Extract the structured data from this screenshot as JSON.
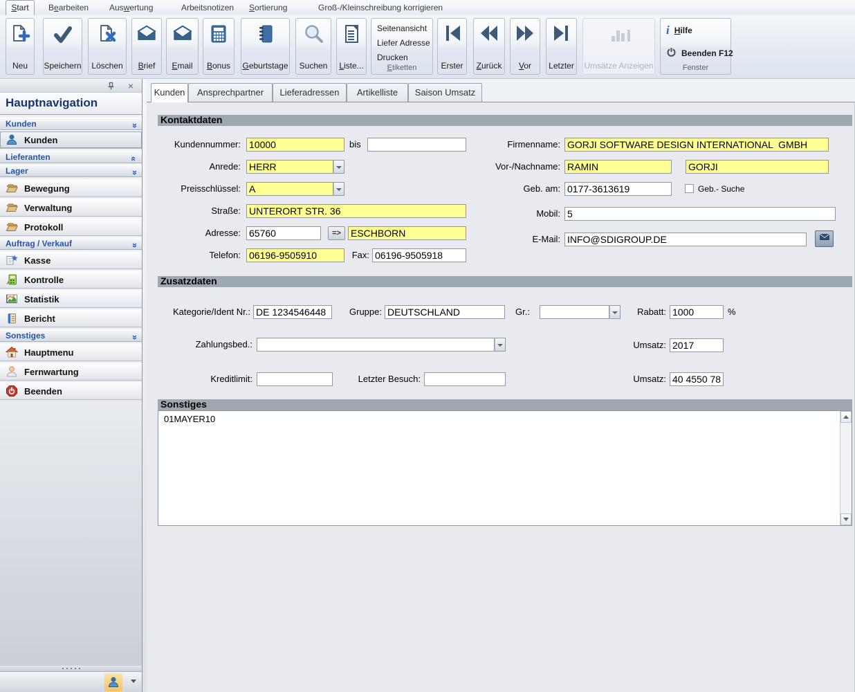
{
  "colors": {
    "field_yellow": "#FFFF94",
    "section_bar_gray": "#9EA8B1",
    "sidebar_header_text": "#2456AE",
    "nav_title_text": "#17356E",
    "ribbon_icon_blue": "#2F6BBF",
    "ribbon_icon_slate": "#3D5A78"
  },
  "icons": {
    "neu": "document-plus-icon",
    "speichern": "checkmark-icon",
    "loeschen": "document-x-icon",
    "brief": "envelope-icon",
    "email": "envelope-icon",
    "bonus": "calculator-icon",
    "geburtstage": "notebook-icon",
    "suchen": "magnifier-icon",
    "liste": "list-document-icon",
    "erster": "first-record-icon",
    "zurueck": "previous-record-icon",
    "vor": "next-record-icon",
    "letzter": "last-record-icon",
    "umsaetze": "bar-chart-icon",
    "hilfe": "info-icon",
    "beenden": "power-icon",
    "kunden": "person-blue-icon",
    "lager": "folder-icon",
    "kasse": "sheet-star-icon",
    "kontrolle": "calculator-green-icon",
    "statistik": "chart-icon",
    "bericht": "book-icon",
    "hauptmenu": "house-icon",
    "fernwartung": "person-icon",
    "beenden_rot": "power-red-icon"
  },
  "menu": {
    "items": [
      {
        "label": "_S_tart",
        "active": true
      },
      {
        "label": "B_e_arbeiten"
      },
      {
        "label": "Aus_w_ertung"
      },
      {
        "label": "Arbeitsnotizen"
      },
      {
        "label": "_S_ortierung"
      },
      {
        "label": "Groß-/Kleinschreibung korrigieren"
      }
    ]
  },
  "ribbon": {
    "neu": "Neu",
    "speichern": "Speichern",
    "loeschen": "Löschen",
    "brief": "_B_rief",
    "email": "_E_mail",
    "bonus": "_B_onus",
    "geburtstage": "_G_eburtstage",
    "suchen": "Suchen",
    "liste": "_L_iste...",
    "etiketten": {
      "items": [
        "Seitenansicht",
        "Liefer Adresse",
        "Drucken"
      ],
      "label": "_E_tiketten"
    },
    "erster": "Erster",
    "zurueck": "_Z_urück",
    "vor": "_V_or",
    "letzter": "Letzter",
    "umsaetze": "Umsätze Anzeigen",
    "fenster": {
      "hilfe": "_H_ilfe",
      "beenden": "Beenden F12",
      "label": "Fenster"
    }
  },
  "sidebar": {
    "title": "Hauptnavigation",
    "rows": [
      {
        "type": "header",
        "label": "Kunden",
        "chevron": "up"
      },
      {
        "type": "item",
        "label": "Kunden",
        "icon": "person-blue-icon",
        "selected": true
      },
      {
        "type": "header",
        "label": "Lieferanten",
        "chevron": "down"
      },
      {
        "type": "header",
        "label": "Lager",
        "chevron": "up"
      },
      {
        "type": "item",
        "label": "Bewegung",
        "icon": "folder-icon"
      },
      {
        "type": "item",
        "label": "Verwaltung",
        "icon": "folder-icon"
      },
      {
        "type": "item",
        "label": "Protokoll",
        "icon": "folder-icon"
      },
      {
        "type": "header",
        "label": "Auftrag / Verkauf",
        "chevron": "up"
      },
      {
        "type": "item",
        "label": "Kasse",
        "icon": "sheet-star-icon"
      },
      {
        "type": "item",
        "label": "Kontrolle",
        "icon": "calculator-green-icon"
      },
      {
        "type": "item",
        "label": "Statistik",
        "icon": "chart-icon"
      },
      {
        "type": "item",
        "label": "Bericht",
        "icon": "book-icon"
      },
      {
        "type": "header",
        "label": "Sonstiges",
        "chevron": "up"
      },
      {
        "type": "item",
        "label": "Hauptmenu",
        "icon": "house-icon"
      },
      {
        "type": "item",
        "label": "Fernwartung",
        "icon": "person-icon"
      },
      {
        "type": "item",
        "label": "Beenden",
        "icon": "power-red-icon"
      }
    ]
  },
  "tabs": {
    "items": [
      "Kunden",
      "Ansprechpartner",
      "Lieferadressen",
      "Artikelliste",
      "Saison Umsatz"
    ],
    "active": "Kunden"
  },
  "form": {
    "kontakt": {
      "title": "Kontaktdaten",
      "kundennummer_label": "Kundennummer:",
      "kundennummer_value": "10000",
      "bis_label": "bis",
      "bis_value": "",
      "anrede_label": "Anrede:",
      "anrede_value": "HERR",
      "preisschluessel_label": "Preisschlüssel:",
      "preisschluessel_value": "A",
      "strasse_label": "Straße:",
      "strasse_value": "UNTERORT STR. 36",
      "adresse_label": "Adresse:",
      "plz_value": "65760",
      "plz_zu_ort_button": "=>",
      "ort_value": "ESCHBORN",
      "telefon_label": "Telefon:",
      "telefon_value": "06196-9505910",
      "fax_label": "Fax:",
      "fax_value": "06196-9505918",
      "firmenname_label": "Firmenname:",
      "firmenname_value": "GORJI SOFTWARE DESIGN INTERNATIONAL  GMBH",
      "vor_nachname_label": "Vor-/Nachname:",
      "vorname_value": "RAMIN",
      "nachname_value": "GORJI",
      "geb_am_label": "Geb. am:",
      "geb_am_value": "0177-3613619",
      "geb_suche_label": "Geb.- Suche",
      "geb_suche_checked": false,
      "mobil_label": "Mobil:",
      "mobil_value": "5",
      "email_label": "E-Mail:",
      "email_value": "INFO@SDIGROUP.DE"
    },
    "zusatz": {
      "title": "Zusatzdaten",
      "kategorie_label": "Kategorie/Ident Nr.:",
      "kategorie_value": "DE 1234546448",
      "gruppe_label": "Gruppe:",
      "gruppe_value": "DEUTSCHLAND",
      "gr_label": "Gr.:",
      "gr_value": "",
      "rabatt_label": "Rabatt:",
      "rabatt_value": "1000",
      "rabatt_unit": "%",
      "zahlungsbed_label": "Zahlungsbed.:",
      "zahlungsbed_value": "",
      "umsatz1_label": "Umsatz:",
      "umsatz1_value": "2017",
      "kreditlimit_label": "Kreditlimit:",
      "kreditlimit_value": "",
      "letzter_besuch_label": "Letzter Besuch:",
      "letzter_besuch_value": "",
      "umsatz2_label": "Umsatz:",
      "umsatz2_value": "40 4550 78"
    },
    "sonstiges": {
      "title": "Sonstiges",
      "text": "01MAYER10"
    }
  }
}
